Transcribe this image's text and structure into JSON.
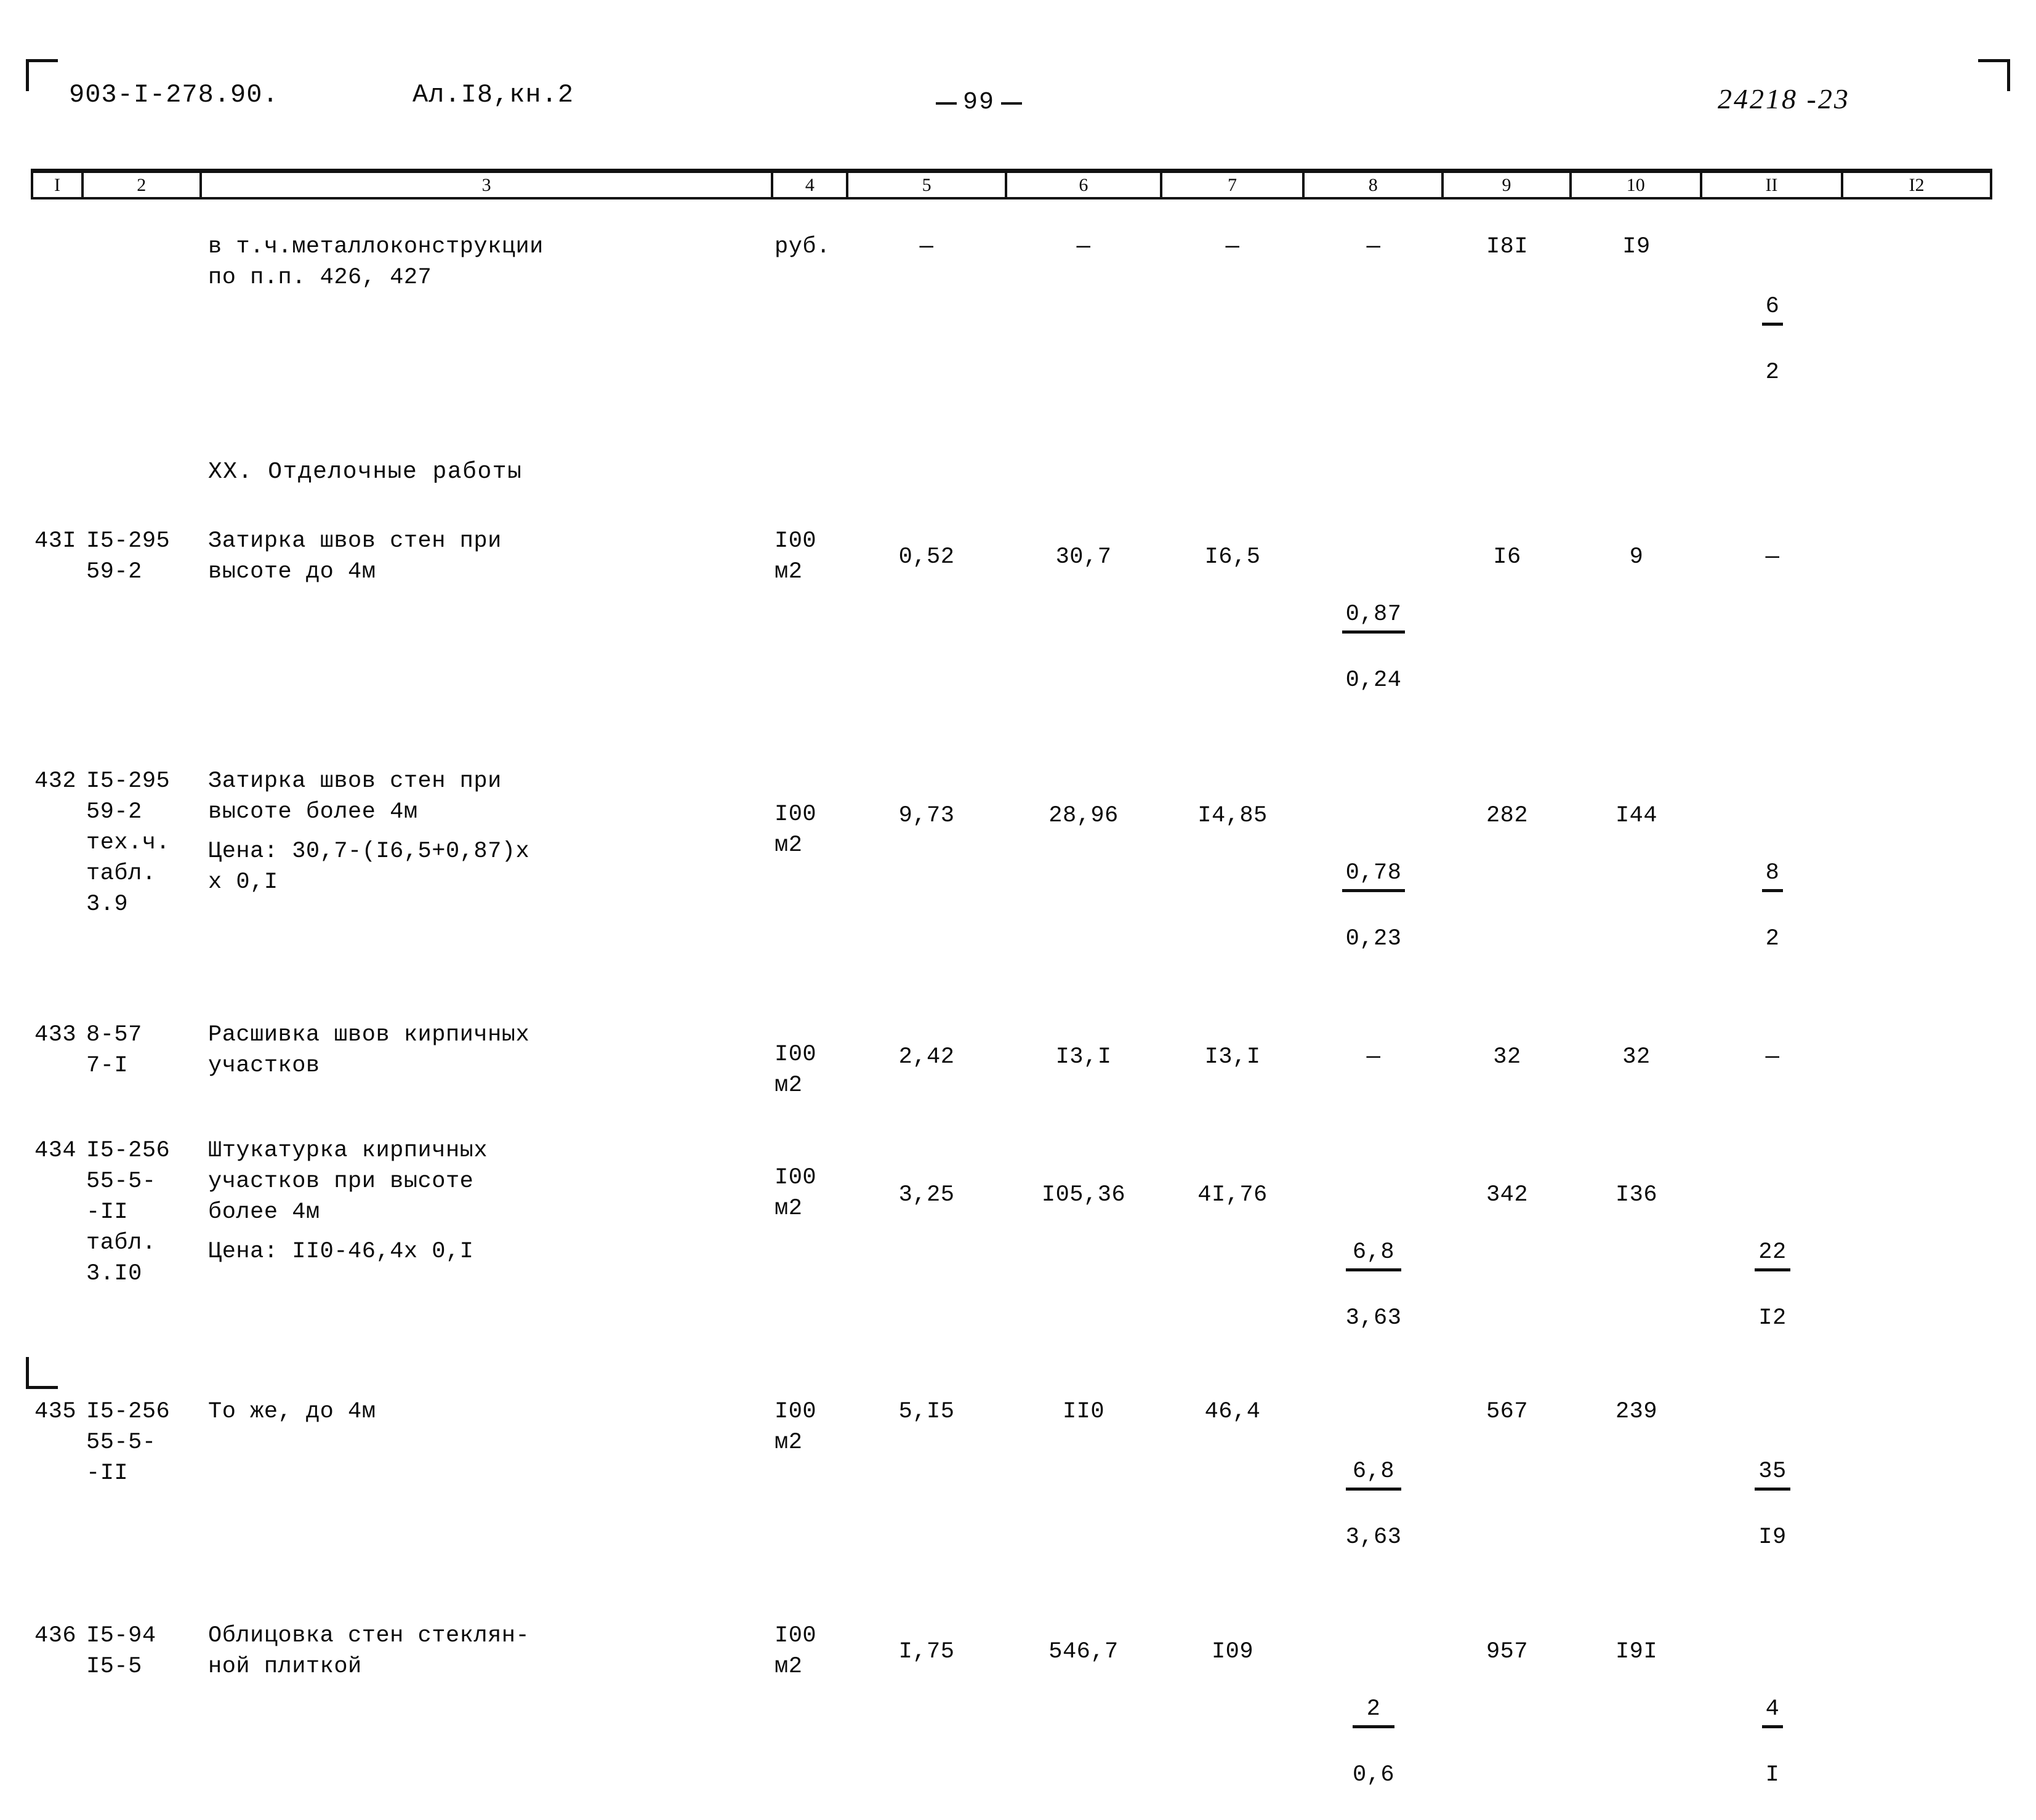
{
  "header": {
    "doc_code": "903-I-278.90.",
    "album": "Ал.I8,кн.2",
    "page_number": "99",
    "archive_stamp": "24218 -23"
  },
  "table": {
    "column_headers": [
      "I",
      "2",
      "3",
      "4",
      "5",
      "6",
      "7",
      "8",
      "9",
      "10",
      "II",
      "I2"
    ],
    "rows": [
      {
        "num": "",
        "code": "",
        "desc": "в т.ч.металлоконструкции\nпо п.п. 426, 427",
        "unit": "руб.",
        "c5": "—",
        "c6": "—",
        "c7": "—",
        "c8": "—",
        "c9": "I8I",
        "c10": "I9",
        "c11_top": "6",
        "c11_bot": "2",
        "c12": ""
      },
      {
        "num": "",
        "code": "",
        "desc": "XX. Отделочные работы",
        "unit": "",
        "c5": "",
        "c6": "",
        "c7": "",
        "c8": "",
        "c9": "",
        "c10": "",
        "c11_top": "",
        "c11_bot": "",
        "c12": ""
      },
      {
        "num": "43I",
        "code": "I5-295\n59-2",
        "desc": "Затирка  швов стен при\nвысоте до 4м",
        "unit": "I00\nм2",
        "c5": "0,52",
        "c6": "30,7",
        "c7": "I6,5",
        "c8_top": "0,87",
        "c8_bot": "0,24",
        "c9": "I6",
        "c10": "9",
        "c11": "—",
        "c12": ""
      },
      {
        "num": "432",
        "code": "I5-295\n59-2\nтех.ч.\nтабл.\n3.9",
        "desc": "Затирка швов стен при\nвысоте более 4м",
        "desc2": "Цена: 30,7-(I6,5+0,87)х\n              х 0,I",
        "unit": "I00\nм2",
        "c5": "9,73",
        "c6": "28,96",
        "c7": "I4,85",
        "c8_top": "0,78",
        "c8_bot": "0,23",
        "c9": "282",
        "c10": "I44",
        "c11_top": "8",
        "c11_bot": "2",
        "c12": ""
      },
      {
        "num": "433",
        "code": "8-57\n7-I",
        "desc": "Расшивка швов кирпичных\nучастков",
        "unit": "I00\nм2",
        "c5": "2,42",
        "c6": "I3,I",
        "c7": "I3,I",
        "c8": "—",
        "c9": "32",
        "c10": "32",
        "c11": "—",
        "c12": ""
      },
      {
        "num": "434",
        "code": "I5-256\n55-5-\n-II\nтабл.\n3.I0",
        "desc": "Штукатурка кирпичных\nучастков при высоте\nболее 4м",
        "desc2": "Цена: II0-46,4х 0,I",
        "unit": "I00\nм2",
        "c5": "3,25",
        "c6": "I05,36",
        "c7": "4I,76",
        "c8_top": "6,8",
        "c8_bot": "3,63",
        "c9": "342",
        "c10": "I36",
        "c11_top": "22",
        "c11_bot": "I2",
        "c12": ""
      },
      {
        "num": "435",
        "code": "I5-256\n55-5-\n-II",
        "desc": "То же, до 4м",
        "unit": "I00\nм2",
        "c5": "5,I5",
        "c6": "II0",
        "c7": "46,4",
        "c8_top": "6,8",
        "c8_bot": "3,63",
        "c9": "567",
        "c10": "239",
        "c11_top": "35",
        "c11_bot": "I9",
        "c12": ""
      },
      {
        "num": "436",
        "code": "I5-94\nI5-5",
        "desc": "Облицовка стен стеклян-\nной плиткой",
        "unit": "I00\nм2",
        "c5": "I,75",
        "c6": "546,7",
        "c7": "I09",
        "c8_top": "2",
        "c8_bot": "0,6",
        "c9": "957",
        "c10": "I9I",
        "c11_top": "4",
        "c11_bot": "I",
        "c12": ""
      }
    ]
  }
}
